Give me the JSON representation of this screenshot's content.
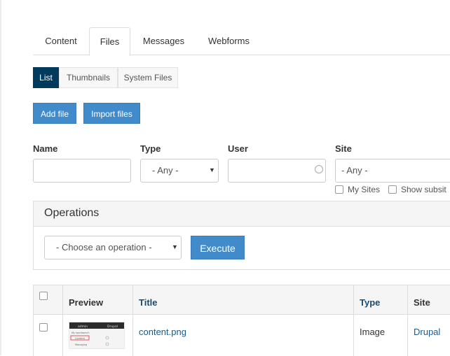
{
  "tabs": [
    "Content",
    "Files",
    "Messages",
    "Webforms"
  ],
  "subtabs": [
    "List",
    "Thumbnails",
    "System Files"
  ],
  "actions": {
    "add_file": "Add file",
    "import_files": "Import files"
  },
  "filters": {
    "name_label": "Name",
    "type_label": "Type",
    "type_value": "- Any -",
    "user_label": "User",
    "site_label": "Site",
    "site_value": "- Any -",
    "my_sites_label": "My Sites",
    "show_subsites_label": "Show subsit"
  },
  "operations": {
    "title": "Operations",
    "select_value": "- Choose an operation -",
    "execute_label": "Execute"
  },
  "table": {
    "headers": {
      "preview": "Preview",
      "title": "Title",
      "type": "Type",
      "site": "Site"
    },
    "rows": [
      {
        "title": "content.png",
        "type": "Image",
        "site": "Drupal"
      }
    ],
    "thumbnail": {
      "user": "admin",
      "site": "Drupal",
      "item1": "My workbench",
      "item2": "Content",
      "item3": "Managing"
    }
  },
  "colors": {
    "accent": "#428bca",
    "active_subtab": "#003a5c",
    "link": "#1a5a8a"
  }
}
